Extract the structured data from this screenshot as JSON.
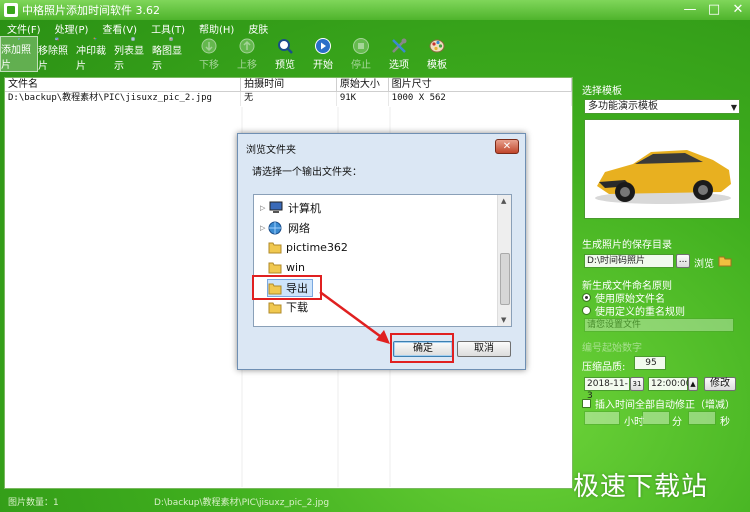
{
  "window": {
    "title": "中格照片添加时间软件 3.62",
    "minimize": "—",
    "maximize": "□",
    "close": "✕"
  },
  "menu": [
    "文件(F)",
    "处理(P)",
    "查看(V)",
    "工具(T)",
    "帮助(H)",
    "皮肤"
  ],
  "toolbar": [
    {
      "label": "添加照片",
      "icon": "add-photo-icon",
      "state": "active"
    },
    {
      "label": "移除照片",
      "icon": "remove-photo-icon",
      "state": "normal"
    },
    {
      "label": "冲印裁片",
      "icon": "crop-icon",
      "state": "normal"
    },
    {
      "label": "列表显示",
      "icon": "list-view-icon",
      "state": "normal"
    },
    {
      "label": "略图显示",
      "icon": "thumbnail-view-icon",
      "state": "normal"
    },
    {
      "label": "下移",
      "icon": "move-down-icon",
      "state": "disabled"
    },
    {
      "label": "上移",
      "icon": "move-up-icon",
      "state": "disabled"
    },
    {
      "label": "预览",
      "icon": "preview-icon",
      "state": "normal"
    },
    {
      "label": "开始",
      "icon": "start-icon",
      "state": "normal"
    },
    {
      "label": "停止",
      "icon": "stop-icon",
      "state": "disabled"
    },
    {
      "label": "选项",
      "icon": "options-icon",
      "state": "normal"
    },
    {
      "label": "模板",
      "icon": "template-icon",
      "state": "normal"
    }
  ],
  "table": {
    "columns": [
      "文件名",
      "拍摄时间",
      "原始大小",
      "图片尺寸"
    ],
    "rows": [
      [
        "D:\\backup\\教程素材\\PIC\\jisuxz_pic_2.jpg",
        "无",
        "91K",
        "1000 X 562"
      ]
    ]
  },
  "right_panel": {
    "template_label": "选择模板",
    "template_value": "多功能演示模板",
    "save_dir_label": "生成照片的保存目录",
    "save_dir_value": "D:\\时间码照片",
    "browse_ellipsis": "...",
    "browse_label": "浏览",
    "naming_label": "新生成文件命名原则",
    "naming_options": [
      "使用原始文件名",
      "使用定义的重名规则"
    ],
    "naming_selected": 0,
    "faded_field": "请您设置文件",
    "faded_label": "编号起始数字",
    "quality_label": "压缩品质:",
    "quality_value": "95",
    "date_value": "2018-11-3",
    "date_badge": "31",
    "time_value": "12:00:00",
    "modify_label": "修改",
    "auto_correct_label": "插入时间全部自动修正（增减）",
    "hour_label": "小时",
    "minute_label": "分",
    "second_label": "秒"
  },
  "status": {
    "count_label": "图片数量：1",
    "path": "D:\\backup\\教程素材\\PIC\\jisuxz_pic_2.jpg"
  },
  "watermark": "极速下载站",
  "dialog": {
    "title": "浏览文件夹",
    "close": "✕",
    "prompt": "请选择一个输出文件夹：",
    "tree": [
      {
        "label": "计算机",
        "icon": "computer-icon",
        "expander": "▷"
      },
      {
        "label": "网络",
        "icon": "network-icon",
        "expander": "▷"
      },
      {
        "label": "pictime362",
        "icon": "folder-icon",
        "expander": ""
      },
      {
        "label": "win",
        "icon": "folder-icon",
        "expander": ""
      },
      {
        "label": "导出",
        "icon": "folder-icon",
        "expander": ""
      },
      {
        "label": "下载",
        "icon": "folder-icon",
        "expander": ""
      }
    ],
    "ok": "确定",
    "cancel": "取消"
  },
  "colors": {
    "app_green": "#3fae1e",
    "highlight_red": "#e02020",
    "dialog_bg": "#dbe7f4"
  }
}
